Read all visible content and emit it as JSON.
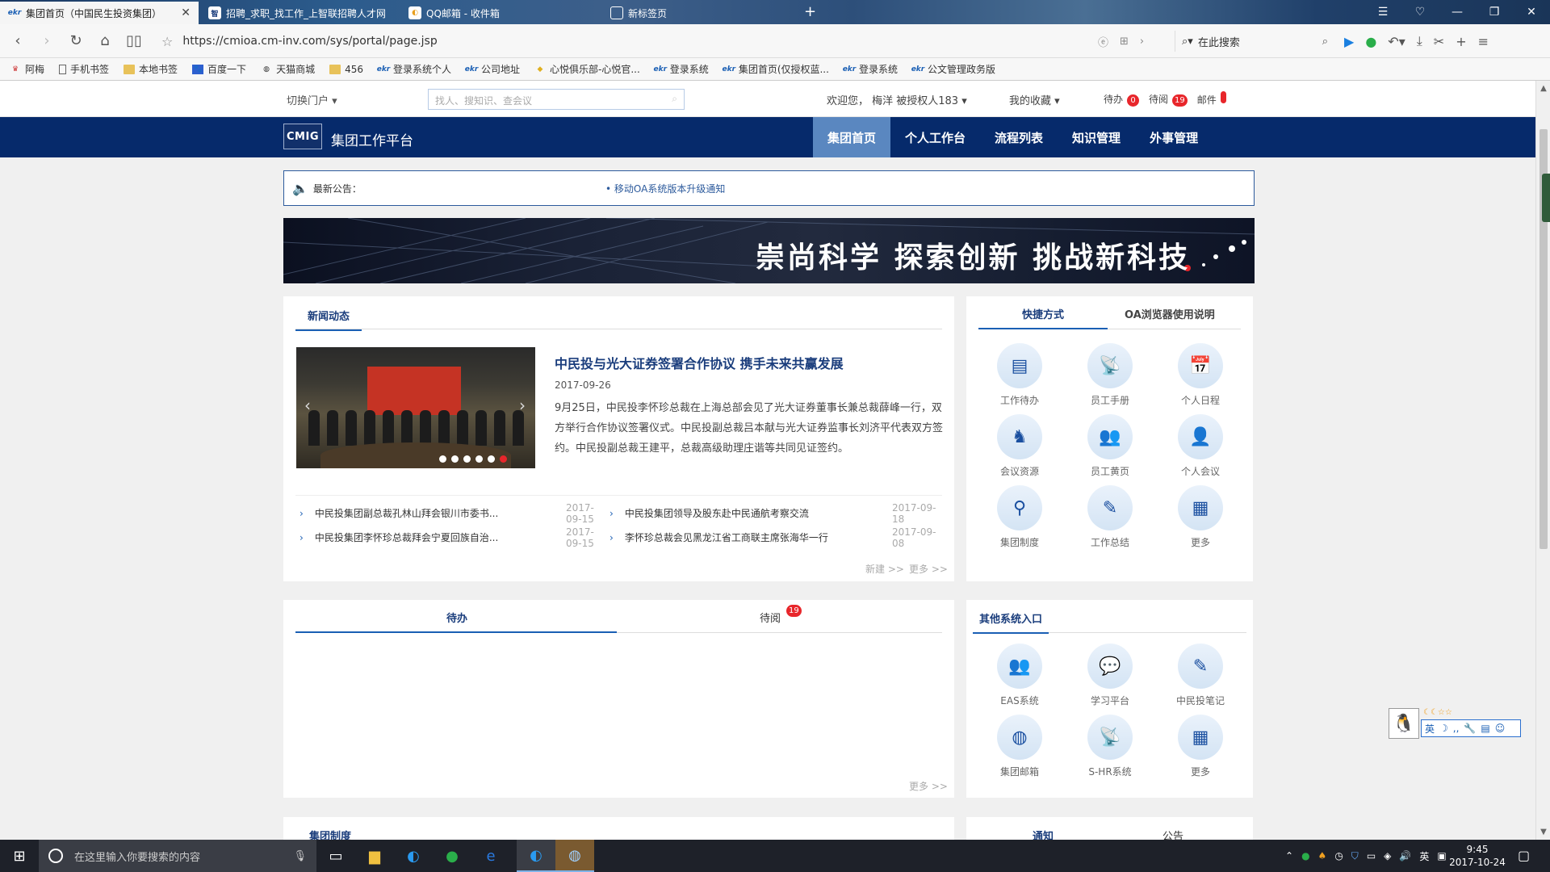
{
  "browser": {
    "tabs": [
      {
        "label": "集团首页（中国民生投资集团）",
        "active": true
      },
      {
        "label": "招聘_求职_找工作_上智联招聘人才网"
      },
      {
        "label": "QQ邮箱 - 收件箱"
      },
      {
        "label": "新标签页"
      }
    ],
    "url": "https://cmioa.cm-inv.com/sys/portal/page.jsp",
    "search_placeholder": "在此搜索",
    "bookmarks": [
      "阿梅",
      "手机书签",
      "本地书签",
      "百度一下",
      "天猫商城",
      "456",
      "登录系统个人",
      "公司地址",
      "心悦俱乐部-心悦官...",
      "登录系统",
      "集团首页(仅授权蓝...",
      "登录系统",
      "公文管理政务版"
    ]
  },
  "portal": {
    "switch_label": "切换门户",
    "search_placeholder": "找人、搜知识、查会议",
    "welcome": "欢迎您， 梅洋 被授权人183",
    "favorites": "我的收藏",
    "todo_label": "待办",
    "todo_count": "0",
    "toread_label": "待阅",
    "toread_count": "19",
    "mail_label": "邮件",
    "logo": "CMIG",
    "platform": "集团工作平台",
    "menu": [
      "集团首页",
      "个人工作台",
      "流程列表",
      "知识管理",
      "外事管理"
    ],
    "notice_label": "最新公告：",
    "notice_item": "• 移动OA系统版本升级通知",
    "banner_slogan": "崇尚科学  探索创新  挑战新科技"
  },
  "news": {
    "tab": "新闻动态",
    "headline": "中民投与光大证券签署合作协议 携手未来共赢发展",
    "date": "2017-09-26",
    "body": "9月25日，中民投李怀珍总裁在上海总部会见了光大证券董事长兼总裁薛峰一行，双方举行合作协议签署仪式。中民投副总裁吕本献与光大证券监事长刘济平代表双方签约。中民投副总裁王建平，总裁高级助理庄谐等共同见证签约。",
    "items": [
      {
        "title": "中民投集团副总裁孔林山拜会银川市委书...",
        "date": "2017-09-15"
      },
      {
        "title": "中民投集团领导及股东赴中民通航考察交流",
        "date": "2017-09-18"
      },
      {
        "title": "中民投集团李怀珍总裁拜会宁夏回族自治...",
        "date": "2017-09-15"
      },
      {
        "title": "李怀珍总裁会见黑龙江省工商联主席张海华一行",
        "date": "2017-09-08"
      }
    ],
    "new_link": "新建 >>",
    "more_link": "更多 >>"
  },
  "shortcuts": {
    "tabs": [
      "快捷方式",
      "OA浏览器使用说明"
    ],
    "items": [
      {
        "label": "工作待办",
        "icon": "todo-list-icon",
        "glyph": "▤"
      },
      {
        "label": "员工手册",
        "icon": "satellite-dish-icon",
        "glyph": "📡"
      },
      {
        "label": "个人日程",
        "icon": "calendar-icon",
        "glyph": "📅"
      },
      {
        "label": "会议资源",
        "icon": "meeting-icon",
        "glyph": "♞"
      },
      {
        "label": "员工黄页",
        "icon": "group-icon",
        "glyph": "👥"
      },
      {
        "label": "个人会议",
        "icon": "person-icon",
        "glyph": "👤"
      },
      {
        "label": "集团制度",
        "icon": "stamp-icon",
        "glyph": "⚲"
      },
      {
        "label": "工作总结",
        "icon": "edit-note-icon",
        "glyph": "✎"
      },
      {
        "label": "更多",
        "icon": "grid-icon",
        "glyph": "▦"
      }
    ]
  },
  "tasks": {
    "tabs": [
      "待办",
      "待阅"
    ],
    "toread_badge": "19",
    "more_link": "更多 >>"
  },
  "systems": {
    "tab": "其他系统入口",
    "items": [
      {
        "label": "EAS系统",
        "icon": "group-icon",
        "glyph": "👥"
      },
      {
        "label": "学习平台",
        "icon": "chat-person-icon",
        "glyph": "💬"
      },
      {
        "label": "中民投笔记",
        "icon": "edit-note-icon",
        "glyph": "✎"
      },
      {
        "label": "集团邮箱",
        "icon": "globe-icon",
        "glyph": "◍"
      },
      {
        "label": "S-HR系统",
        "icon": "satellite-dish-icon",
        "glyph": "📡"
      },
      {
        "label": "更多",
        "icon": "grid-icon",
        "glyph": "▦"
      }
    ]
  },
  "bottom": {
    "left_tab": "集团制度",
    "right_tabs": [
      "通知",
      "公告"
    ]
  },
  "taskbar": {
    "search_placeholder": "在这里输入你要搜索的内容",
    "ime": "英",
    "time": "9:45",
    "date": "2017-10-24"
  },
  "colors": {
    "nav_bg": "#062a6b",
    "nav_active": "#5a87c0",
    "badge": "#e8262b",
    "link": "#1a3d7c"
  }
}
